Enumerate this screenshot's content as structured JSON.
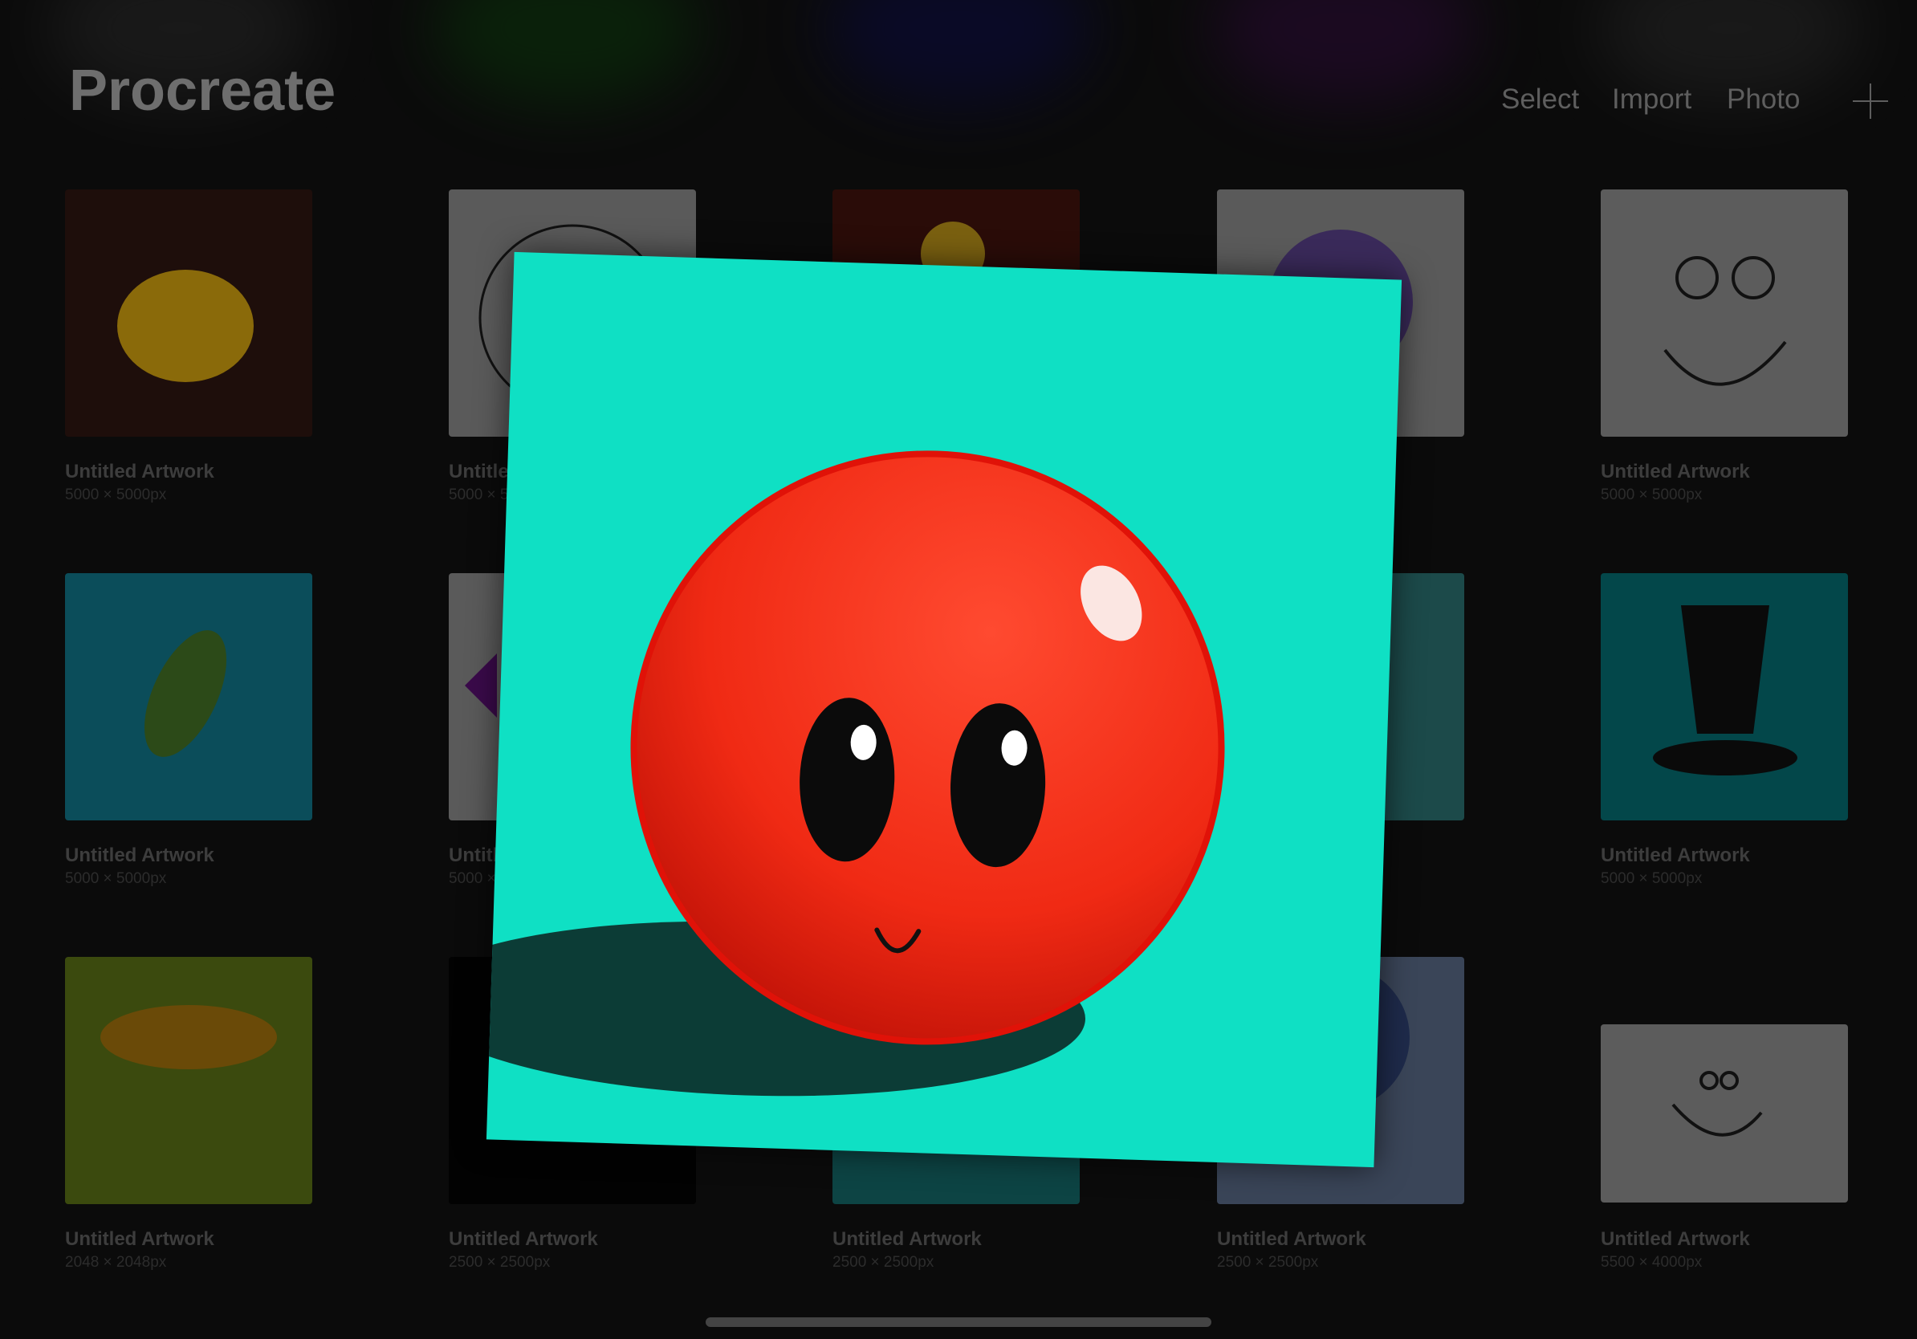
{
  "header": {
    "title": "Procreate",
    "buttons": [
      "Select",
      "Import",
      "Photo"
    ],
    "add_icon": "plus-icon"
  },
  "gallery": [
    {
      "name": "Untitled Artwork",
      "size": "5000 × 5000px",
      "bg": "#1e0e0b"
    },
    {
      "name": "Untitled Artwork",
      "size": "5000 × 5000px",
      "bg": "#5a5a5a"
    },
    {
      "name": "",
      "size": "",
      "bg": "#2a0c08"
    },
    {
      "name": "",
      "size": "",
      "bg": "#5a5a5a"
    },
    {
      "name": "Untitled Artwork",
      "size": "5000 × 5000px",
      "bg": "#5c5c5c"
    },
    {
      "name": "Untitled Artwork",
      "size": "5000 × 5000px",
      "bg": "#0b4d5a"
    },
    {
      "name": "Untitled Artwork",
      "size": "5000 × 5000px",
      "bg": "#5a5a5a"
    },
    {
      "name": "",
      "size": "",
      "bg": "#1c4848"
    },
    {
      "name": "",
      "size": "",
      "bg": "#1c4a4a"
    },
    {
      "name": "Untitled Artwork",
      "size": "5000 × 5000px",
      "bg": "#03474a"
    },
    {
      "name": "Untitled Artwork",
      "size": "2048 × 2048px",
      "bg": "#3b4a0e"
    },
    {
      "name": "Untitled Artwork",
      "size": "2500 × 2500px",
      "bg": "#020202"
    },
    {
      "name": "Untitled Artwork",
      "size": "2500 × 2500px",
      "bg": "#0d4444"
    },
    {
      "name": "Untitled Artwork",
      "size": "2500 × 2500px",
      "bg": "#3a4558"
    },
    {
      "name": "Untitled Artwork",
      "size": "5500 × 4000px",
      "bg": "#5c5c5c"
    }
  ],
  "preview": {
    "bg": "#0fe0c4",
    "ball": "#f02a14"
  }
}
